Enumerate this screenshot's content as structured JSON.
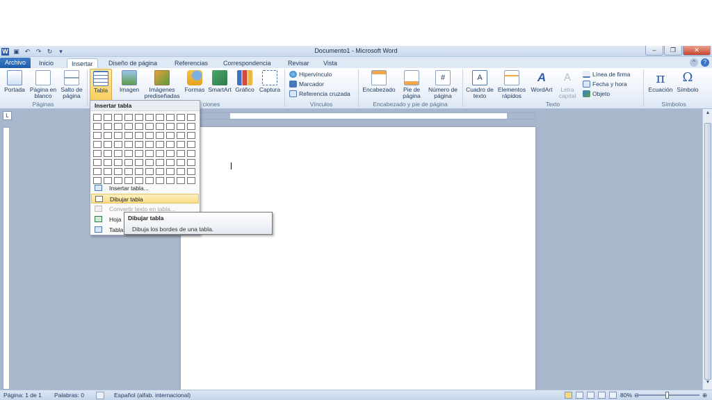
{
  "window": {
    "title": "Documento1  -  Microsoft Word",
    "controls": [
      "minimize",
      "restore",
      "close"
    ]
  },
  "tabs": [
    {
      "label": "Archivo"
    },
    {
      "label": "Inicio"
    },
    {
      "label": "Insertar"
    },
    {
      "label": "Diseño de página"
    },
    {
      "label": "Referencias"
    },
    {
      "label": "Correspondencia"
    },
    {
      "label": "Revisar"
    },
    {
      "label": "Vista"
    }
  ],
  "ribbon": {
    "paginas": {
      "portada": "Portada",
      "pagina_en_blanco": "Página en blanco",
      "salto_de_pagina": "Salto de página",
      "group": "Páginas"
    },
    "tablas": {
      "tabla": "Tabla"
    },
    "ilustraciones": {
      "imagen": "Imagen",
      "imagenes": "Imágenes prediseñadas",
      "formas": "Formas",
      "smartart": "SmartArt",
      "grafico": "Gráfico",
      "captura": "Captura",
      "group": "ciones"
    },
    "vinculos": {
      "hipervinculo": "Hipervínculo",
      "marcador": "Marcador",
      "referencia": "Referencia cruzada",
      "group": "Vínculos"
    },
    "encabezado": {
      "encabezado": "Encabezado",
      "pie": "Pie de página",
      "numero": "Número de página",
      "group": "Encabezado y pie de página"
    },
    "texto": {
      "cuadro": "Cuadro de texto",
      "elementos": "Elementos rápidos",
      "wordart": "WordArt",
      "letra": "Letra capital",
      "linea": "Línea de firma",
      "fecha": "Fecha y hora",
      "objeto": "Objeto",
      "group": "Texto"
    },
    "simbolos": {
      "ecuacion": "Ecuación",
      "simbolo": "Símbolo",
      "group": "Símbolos"
    }
  },
  "dropdown": {
    "header": "Insertar tabla",
    "items": [
      {
        "label": "Insertar tabla..."
      },
      {
        "label": "Dibujar tabla"
      },
      {
        "label": "Convertir texto en tabla..."
      },
      {
        "label": "Hoja"
      },
      {
        "label": "Tabla"
      }
    ]
  },
  "tooltip": {
    "title": "Dibujar tabla",
    "body": "Dibuja los bordes de una tabla."
  },
  "statusbar": {
    "page": "Página: 1 de 1",
    "words": "Palabras: 0",
    "language": "Español (alfab. internacional)",
    "zoom": "80%"
  },
  "colors": {
    "file_tab": "#2a6ab8",
    "hover": "#f9d978"
  },
  "icons": [
    "word-icon",
    "save-icon",
    "undo-icon",
    "redo-icon",
    "help-icon",
    "table-icon",
    "pen-icon"
  ]
}
